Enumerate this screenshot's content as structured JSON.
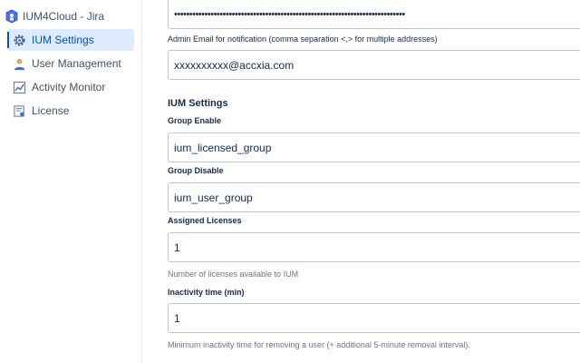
{
  "sidebar": {
    "app_title": "IUM4Cloud - Jira",
    "items": [
      {
        "label": "IUM Settings",
        "icon": "gear-icon",
        "active": true
      },
      {
        "label": "User Management",
        "icon": "user-icon",
        "active": false
      },
      {
        "label": "Activity Monitor",
        "icon": "chart-icon",
        "active": false
      },
      {
        "label": "License",
        "icon": "certificate-icon",
        "active": false
      }
    ]
  },
  "form": {
    "password_value": "••••••••••••••••••••••••••••••••••••••••••••••••••••••••••••••••••••••••••••",
    "admin_email_label": "Admin Email for notification (comma separation <,> for multiple addresses)",
    "admin_email_value": "xxxxxxxxxx@accxia.com",
    "section_title": "IUM Settings",
    "group_enable_label": "Group Enable",
    "group_enable_value": "ium_licensed_group",
    "group_disable_label": "Group Disable",
    "group_disable_value": "ium_user_group",
    "assigned_licenses_label": "Assigned Licenses",
    "assigned_licenses_value": "1",
    "assigned_licenses_hint": "Number of licenses available to IUM",
    "inactivity_label": "Inactivity time (min)",
    "inactivity_value": "1",
    "inactivity_hint": "Minimum inactivity time for removing a user (+ additional 5-minute removal interval)."
  },
  "colors": {
    "accent": "#0052cc",
    "active_bg": "#deebff",
    "border": "#c1c7d0"
  }
}
